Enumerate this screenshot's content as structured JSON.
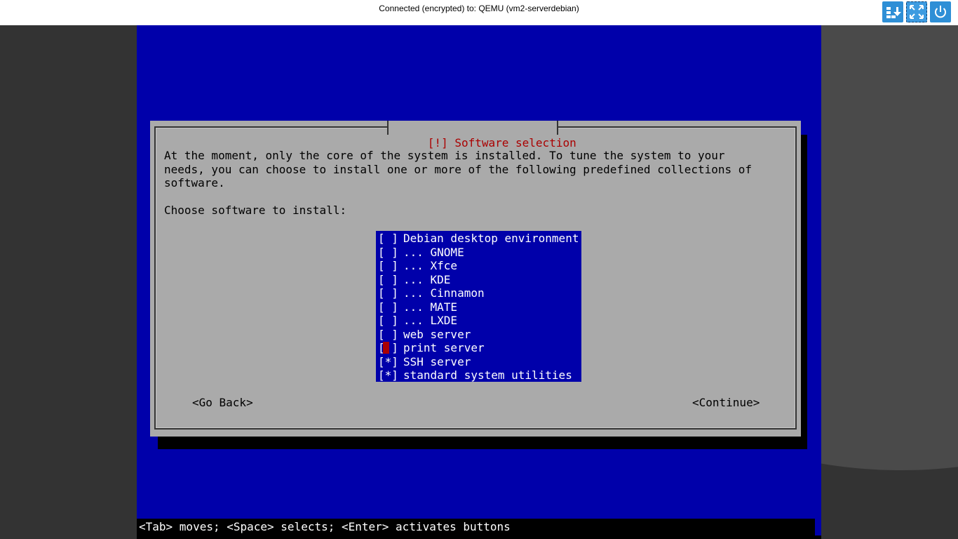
{
  "topbar": {
    "title": "Connected (encrypted) to: QEMU (vm2-serverdebian)",
    "buttons": [
      {
        "name": "send-keys-icon"
      },
      {
        "name": "fullscreen-icon"
      },
      {
        "name": "power-icon"
      }
    ],
    "accent_color": "#2e8fd6"
  },
  "installer": {
    "title": "[!] Software selection",
    "intro": "At the moment, only the core of the system is installed. To tune the system to your\nneeds, you can choose to install one or more of the following predefined collections of\nsoftware.",
    "prompt": "Choose software to install:",
    "items": [
      {
        "mark": "[ ]",
        "label": "Debian desktop environment",
        "checked": false
      },
      {
        "mark": "[ ]",
        "label": "... GNOME",
        "checked": false
      },
      {
        "mark": "[ ]",
        "label": "... Xfce",
        "checked": false
      },
      {
        "mark": "[ ]",
        "label": "... KDE",
        "checked": false
      },
      {
        "mark": "[ ]",
        "label": "... Cinnamon",
        "checked": false
      },
      {
        "mark": "[ ]",
        "label": "... MATE",
        "checked": false
      },
      {
        "mark": "[ ]",
        "label": "... LXDE",
        "checked": false
      },
      {
        "mark": "[ ]",
        "label": "web server",
        "checked": false
      },
      {
        "mark": "[ ]",
        "label": "print server",
        "checked": false,
        "focused": true
      },
      {
        "mark": "[*]",
        "label": "SSH server",
        "checked": true
      },
      {
        "mark": "[*]",
        "label": "standard system utilities",
        "checked": true
      }
    ],
    "back_label": "<Go Back>",
    "continue_label": "<Continue>",
    "status_line": "<Tab> moves; <Space> selects; <Enter> activates buttons",
    "colors": {
      "screen_bg": "#0000aa",
      "dialog_bg": "#aaaaaa",
      "title_fg": "#aa0000",
      "cursor": "#aa0000"
    }
  }
}
